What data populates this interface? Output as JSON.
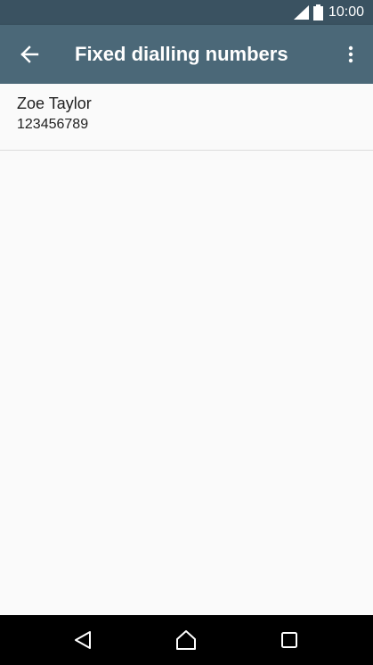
{
  "status_bar": {
    "time": "10:00",
    "icons": [
      "signal-icon",
      "battery-icon"
    ]
  },
  "app_bar": {
    "title": "Fixed dialling numbers",
    "back_icon": "arrow-back-icon",
    "menu_icon": "more-vert-icon"
  },
  "contacts": [
    {
      "name": "Zoe Taylor",
      "number": "123456789"
    }
  ],
  "nav_bar": {
    "icons": [
      "back-triangle-icon",
      "home-icon",
      "recents-icon"
    ]
  },
  "colors": {
    "status_bar": "#3a5261",
    "app_bar": "#4b6878",
    "background": "#fafafa",
    "nav_bar": "#000000",
    "text_primary": "#212121"
  }
}
